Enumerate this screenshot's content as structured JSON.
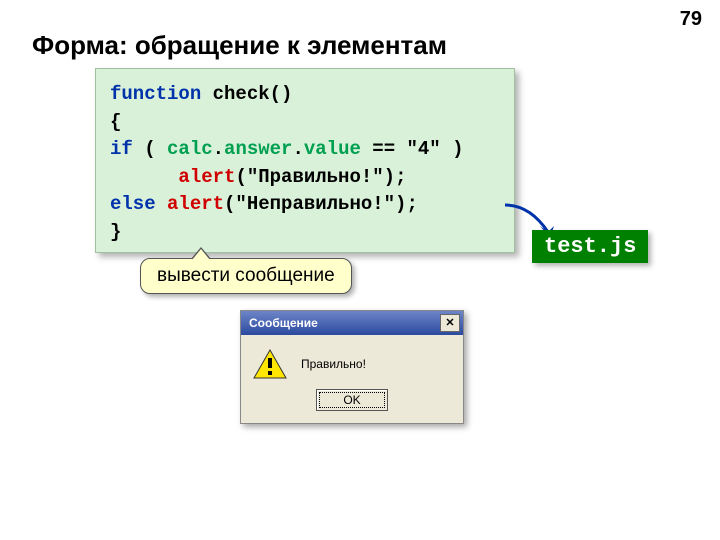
{
  "page_number": "79",
  "title": "Форма: обращение к элементам",
  "code": {
    "l1_kw": "function",
    "l1_name": " check()",
    "l2": "{",
    "l3_kw": "if",
    "l3_open": " ( ",
    "l3_p1": "calc",
    "l3_dot1": ".",
    "l3_p2": "answer",
    "l3_dot2": ".",
    "l3_p3": "value",
    "l3_rest": " == \"4\" )",
    "l4_indent": "      ",
    "l4_fn": "alert",
    "l4_arg": "(\"Правильно!\");",
    "l5_kw": "else",
    "l5_sp": " ",
    "l5_fn": "alert",
    "l5_arg": "(\"Неправильно!\");",
    "l6": "}"
  },
  "callout_text": "вывести сообщение",
  "filename": "test.js",
  "dialog": {
    "title": "Сообщение",
    "close_glyph": "✕",
    "message": "Правильно!",
    "ok_label": "OK"
  }
}
